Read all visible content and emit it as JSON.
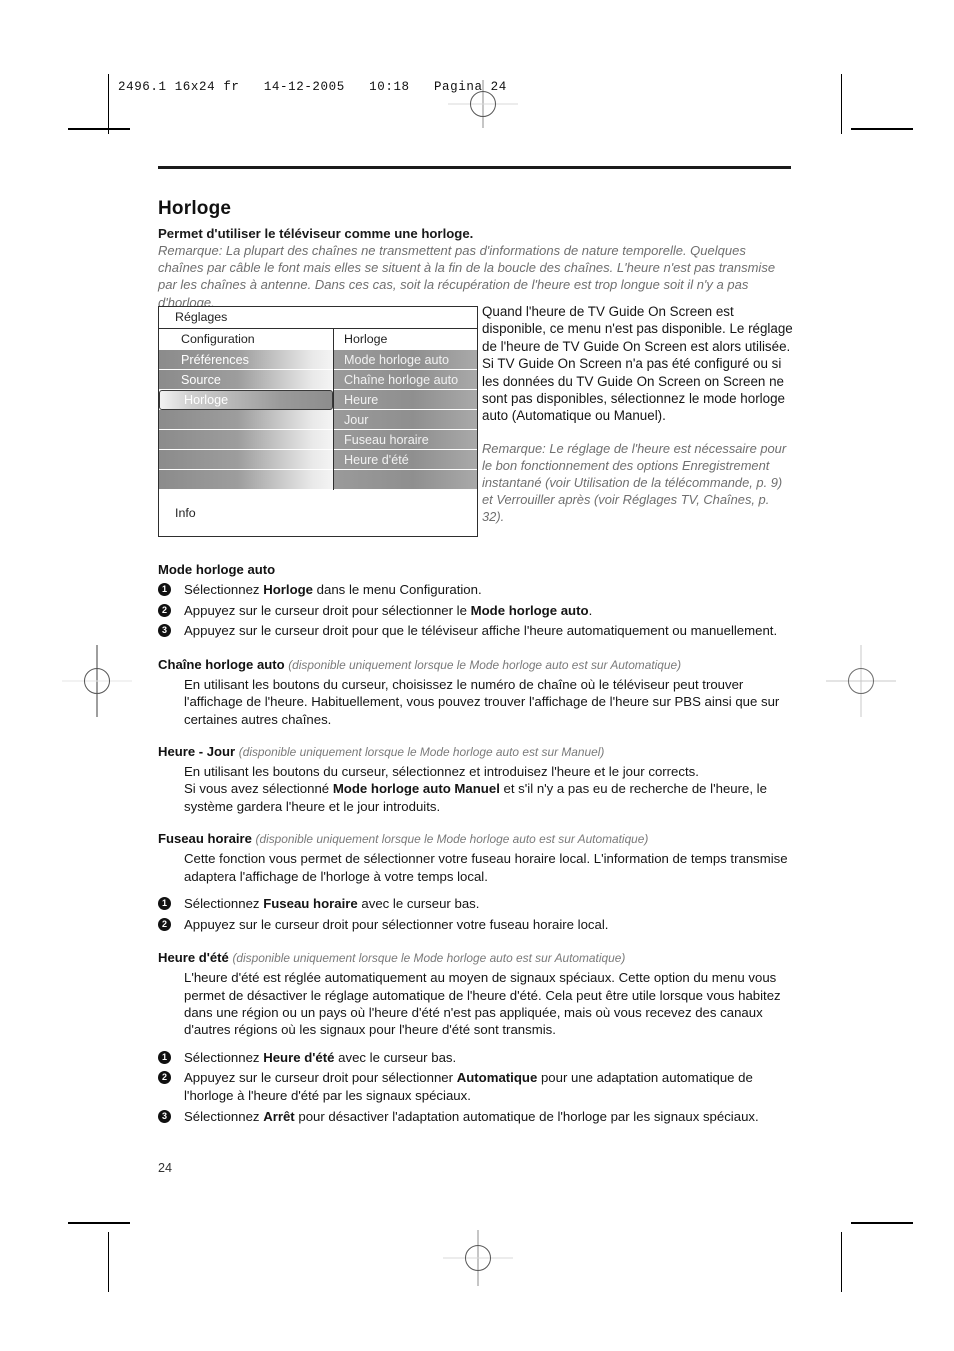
{
  "print": {
    "header_line": "2496.1 16x24 fr   14-12-2005   10:18   Pagina 24",
    "page_number": "24"
  },
  "document": {
    "title": "Horloge",
    "subtitle": "Permet d'utiliser le téléviseur comme une horloge.",
    "remark_top": "Remarque: La plupart des chaînes ne transmettent pas d'informations de nature temporelle. Quelques chaînes par câble le font mais elles se situent à la fin de la boucle des chaînes. L'heure n'est pas transmise par les chaînes à antenne. Dans ces cas, soit la récupération de l'heure est trop longue soit il n'y a pas d'horloge."
  },
  "menu": {
    "window_title": "Réglages",
    "left_column_header": "Configuration",
    "right_column_header": "Horloge",
    "left_items": [
      {
        "label": "Préférences",
        "selected": false
      },
      {
        "label": "Source",
        "selected": false
      },
      {
        "label": "Horloge",
        "selected": true
      },
      {
        "label": "",
        "selected": false
      },
      {
        "label": "",
        "selected": false
      },
      {
        "label": "",
        "selected": false
      },
      {
        "label": "",
        "selected": false
      }
    ],
    "right_items": [
      {
        "label": "Mode horloge auto"
      },
      {
        "label": "Chaîne horloge auto"
      },
      {
        "label": "Heure"
      },
      {
        "label": "Jour"
      },
      {
        "label": "Fuseau horaire"
      },
      {
        "label": "Heure d'été"
      },
      {
        "label": ""
      }
    ],
    "info_label": "Info"
  },
  "side_text": {
    "paragraph": "Quand l'heure de TV Guide On Screen est disponible, ce menu n'est pas disponible. Le réglage de l'heure de TV Guide On Screen est alors utilisée. Si TV Guide On Screen n'a pas été configuré ou si les données du TV Guide On Screen on Screen ne sont pas disponibles, sélectionnez le mode horloge auto (Automatique ou Manuel).",
    "remark": "Remarque: Le réglage de l'heure est nécessaire pour le bon fonctionnement des options Enregistrement instantané (voir Utilisation de la télécommande, p. 9) et Verrouiller après (voir Réglages TV, Chaînes, p. 32)."
  },
  "sections": {
    "mode_horloge_auto": {
      "heading": "Mode horloge auto",
      "steps": [
        {
          "num": "1",
          "html": "Sélectionnez <b>Horloge</b> dans le menu Configuration."
        },
        {
          "num": "2",
          "html": "Appuyez sur le curseur droit pour sélectionner le <b>Mode horloge auto</b>."
        },
        {
          "num": "3",
          "html": "Appuyez sur le curseur droit pour que le téléviseur affiche l'heure automatiquement ou manuellement."
        }
      ]
    },
    "chaine_horloge_auto": {
      "heading": "Chaîne horloge auto",
      "note": "(disponible uniquement lorsque le Mode horloge auto est sur Automatique)",
      "body": "En utilisant les boutons du curseur, choisissez le numéro de chaîne où le téléviseur peut trouver l'affichage de l'heure. Habituellement, vous pouvez trouver l'affichage de l'heure sur PBS ainsi que sur certaines autres chaînes."
    },
    "heure_jour": {
      "heading": "Heure - Jour",
      "note": "(disponible uniquement lorsque le Mode horloge auto est sur Manuel)",
      "body_line1": "En utilisant les boutons du curseur, sélectionnez et introduisez l'heure et le jour corrects.",
      "body_line2_html": "Si vous avez sélectionné <b>Mode horloge auto Manuel</b> et s'il n'y a pas eu de recherche de l'heure, le système gardera l'heure et le jour introduits."
    },
    "fuseau_horaire": {
      "heading": "Fuseau horaire",
      "note": "(disponible uniquement lorsque le Mode horloge auto est sur Automatique)",
      "body": "Cette fonction vous permet de sélectionner votre fuseau horaire local. L'information de temps transmise adaptera l'affichage de l'horloge à votre temps local.",
      "steps": [
        {
          "num": "1",
          "html": "Sélectionnez <b>Fuseau horaire</b> avec le curseur bas."
        },
        {
          "num": "2",
          "html": "Appuyez sur le curseur droit pour sélectionner votre fuseau horaire local."
        }
      ]
    },
    "heure_dete": {
      "heading": "Heure d'été",
      "note": "(disponible uniquement lorsque le Mode horloge auto est sur Automatique)",
      "body": "L'heure d'été est réglée automatiquement au moyen de signaux spéciaux. Cette option du menu vous permet de désactiver le réglage automatique de l'heure d'été. Cela peut être utile lorsque vous habitez dans une région ou un pays où l'heure d'été n'est pas appliquée, mais où vous recevez des canaux d'autres régions où les signaux pour l'heure d'été sont transmis.",
      "steps": [
        {
          "num": "1",
          "html": "Sélectionnez <b>Heure d'été</b> avec le curseur bas."
        },
        {
          "num": "2",
          "html": "Appuyez sur le curseur droit pour sélectionner <b>Automatique</b> pour une adaptation automatique de l'horloge à l'heure d'été par les signaux spéciaux."
        },
        {
          "num": "3",
          "html": "Sélectionnez <b>Arrêt</b> pour désactiver l'adaptation automatique de l'horloge par les signaux spéciaux."
        }
      ]
    }
  },
  "colors": {
    "ink": "#1a1a1a",
    "muted_italic": "#6f6f6f",
    "menu_border": "#2e2e2e",
    "rule": "#1b1b1b"
  }
}
